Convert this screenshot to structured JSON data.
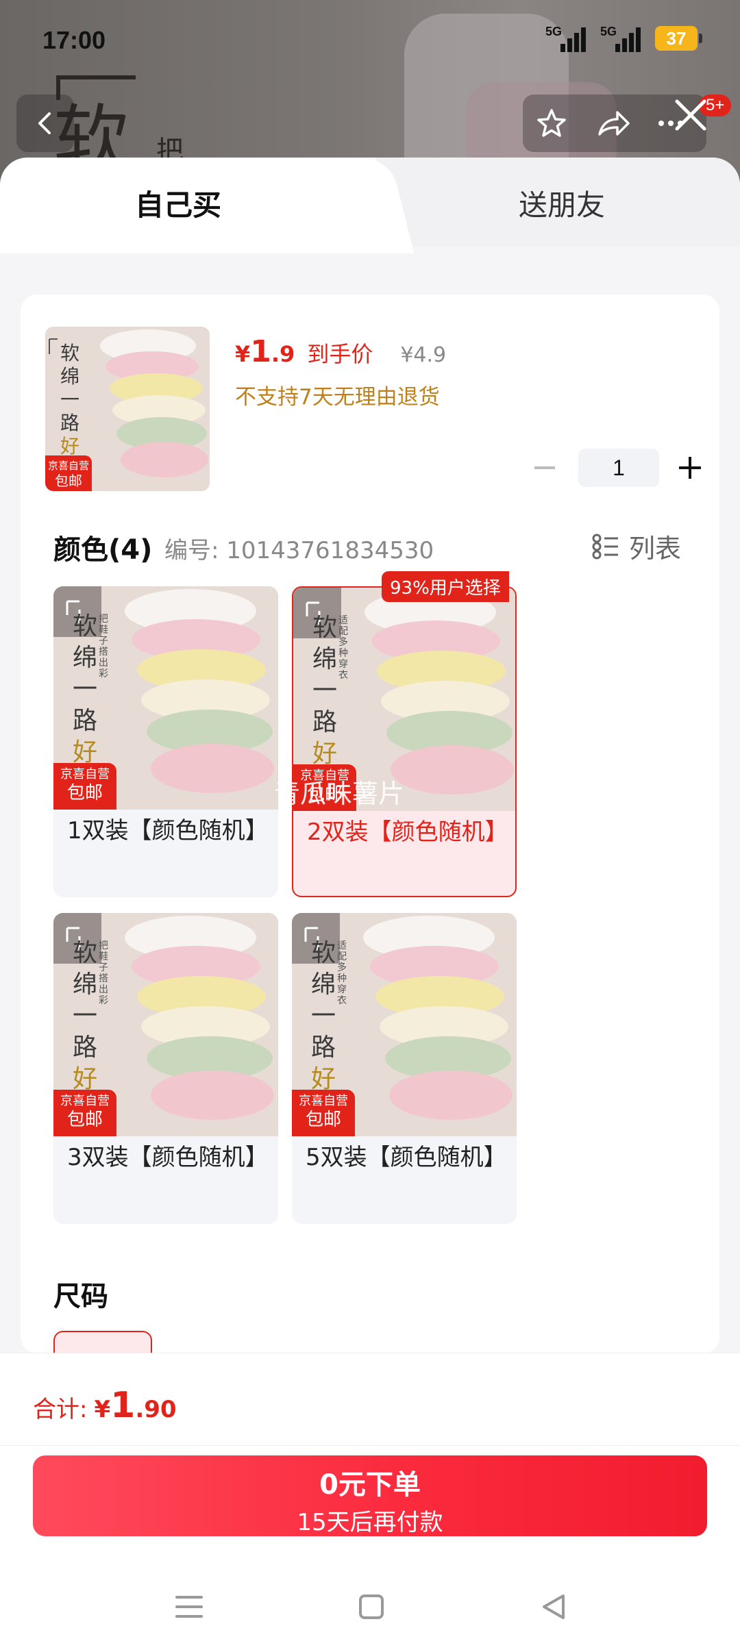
{
  "status_bar": {
    "time": "17:00",
    "signal_1": "5G",
    "signal_2": "5G",
    "battery": "37"
  },
  "header": {
    "cart_badge": "5+"
  },
  "background_banner": {
    "big_char": "软",
    "small_char": "把"
  },
  "tabs": {
    "self": "自己买",
    "friend": "送朋友"
  },
  "product": {
    "price_symbol": "¥",
    "price_integer": "1",
    "price_decimal": ".9",
    "price_tag": "到手价",
    "original_price": "¥4.9",
    "return_policy": "不支持7天无理由退货",
    "quantity": "1",
    "thumb_badge_top": "京喜自营",
    "thumb_badge_bottom": "包邮"
  },
  "color_section": {
    "title": "颜色(4)",
    "code": "编号: 10143761834530",
    "list_label": "列表"
  },
  "image_text": {
    "vertical_1": "软",
    "vertical_2": "绵",
    "vertical_3": "一",
    "vertical_4": "路",
    "vertical_5": "好",
    "side_text": "把鞋子搭出彩",
    "side_text_2": "适配多种穿衣",
    "badge_top": "京喜自营",
    "badge_bottom": "包邮"
  },
  "variants": [
    {
      "label": "1双装【颜色随机】",
      "selected": false
    },
    {
      "label": "2双装【颜色随机】",
      "selected": true,
      "tag": "93%用户选择"
    },
    {
      "label": "3双装【颜色随机】",
      "selected": false
    },
    {
      "label": "5双装【颜色随机】",
      "selected": false
    }
  ],
  "watermark": "青瓜味薯片",
  "size_section": {
    "title": "尺码"
  },
  "footer": {
    "total_label": "合计:",
    "total_symbol": "¥",
    "total_integer": "1",
    "total_decimal": ".90",
    "button_main": "0元下单",
    "button_sub": "15天后再付款"
  },
  "colors": {
    "accent_red": "#e2231a",
    "button_red": "#fb2a3d",
    "warning_orange": "#c0801a",
    "price_grey": "#888888"
  },
  "icons": {
    "back": "chevron-left-icon",
    "favorite": "star-icon",
    "share": "share-icon",
    "more": "more-icon",
    "close": "close-icon",
    "list": "list-view-icon",
    "minus": "minus-icon",
    "plus": "plus-icon"
  }
}
